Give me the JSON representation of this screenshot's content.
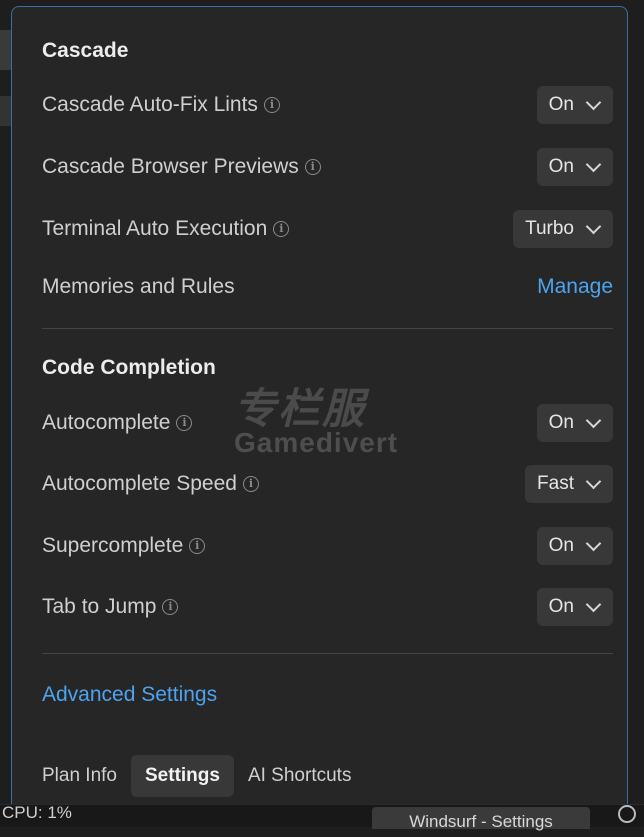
{
  "panel": {
    "sections": {
      "cascade": {
        "title": "Cascade",
        "rows": {
          "auto_fix": {
            "label": "Cascade Auto-Fix Lints",
            "value": "On"
          },
          "browser_previews": {
            "label": "Cascade Browser Previews",
            "value": "On"
          },
          "terminal": {
            "label": "Terminal Auto Execution",
            "value": "Turbo"
          },
          "memories": {
            "label": "Memories and Rules",
            "action": "Manage"
          }
        }
      },
      "code_completion": {
        "title": "Code Completion",
        "rows": {
          "autocomplete": {
            "label": "Autocomplete",
            "value": "On"
          },
          "autocomplete_speed": {
            "label": "Autocomplete Speed",
            "value": "Fast"
          },
          "supercomplete": {
            "label": "Supercomplete",
            "value": "On"
          },
          "tab_to_jump": {
            "label": "Tab to Jump",
            "value": "On"
          }
        }
      }
    },
    "advanced_link": "Advanced Settings",
    "tabs": {
      "plan_info": "Plan Info",
      "settings": "Settings",
      "ai_shortcuts": "AI Shortcuts"
    }
  },
  "statusbar": {
    "cpu": "CPU: 1%",
    "window_title": "Windsurf - Settings"
  },
  "watermark": {
    "cn": "专栏服",
    "en": "Gamedivert"
  },
  "info_glyph": "i",
  "icons": [
    "info-icon",
    "chevron-down-icon",
    "search-icon"
  ],
  "colors": {
    "accent": "#4da3ef",
    "panel_bg": "#262626",
    "border": "#3a6fa5"
  }
}
